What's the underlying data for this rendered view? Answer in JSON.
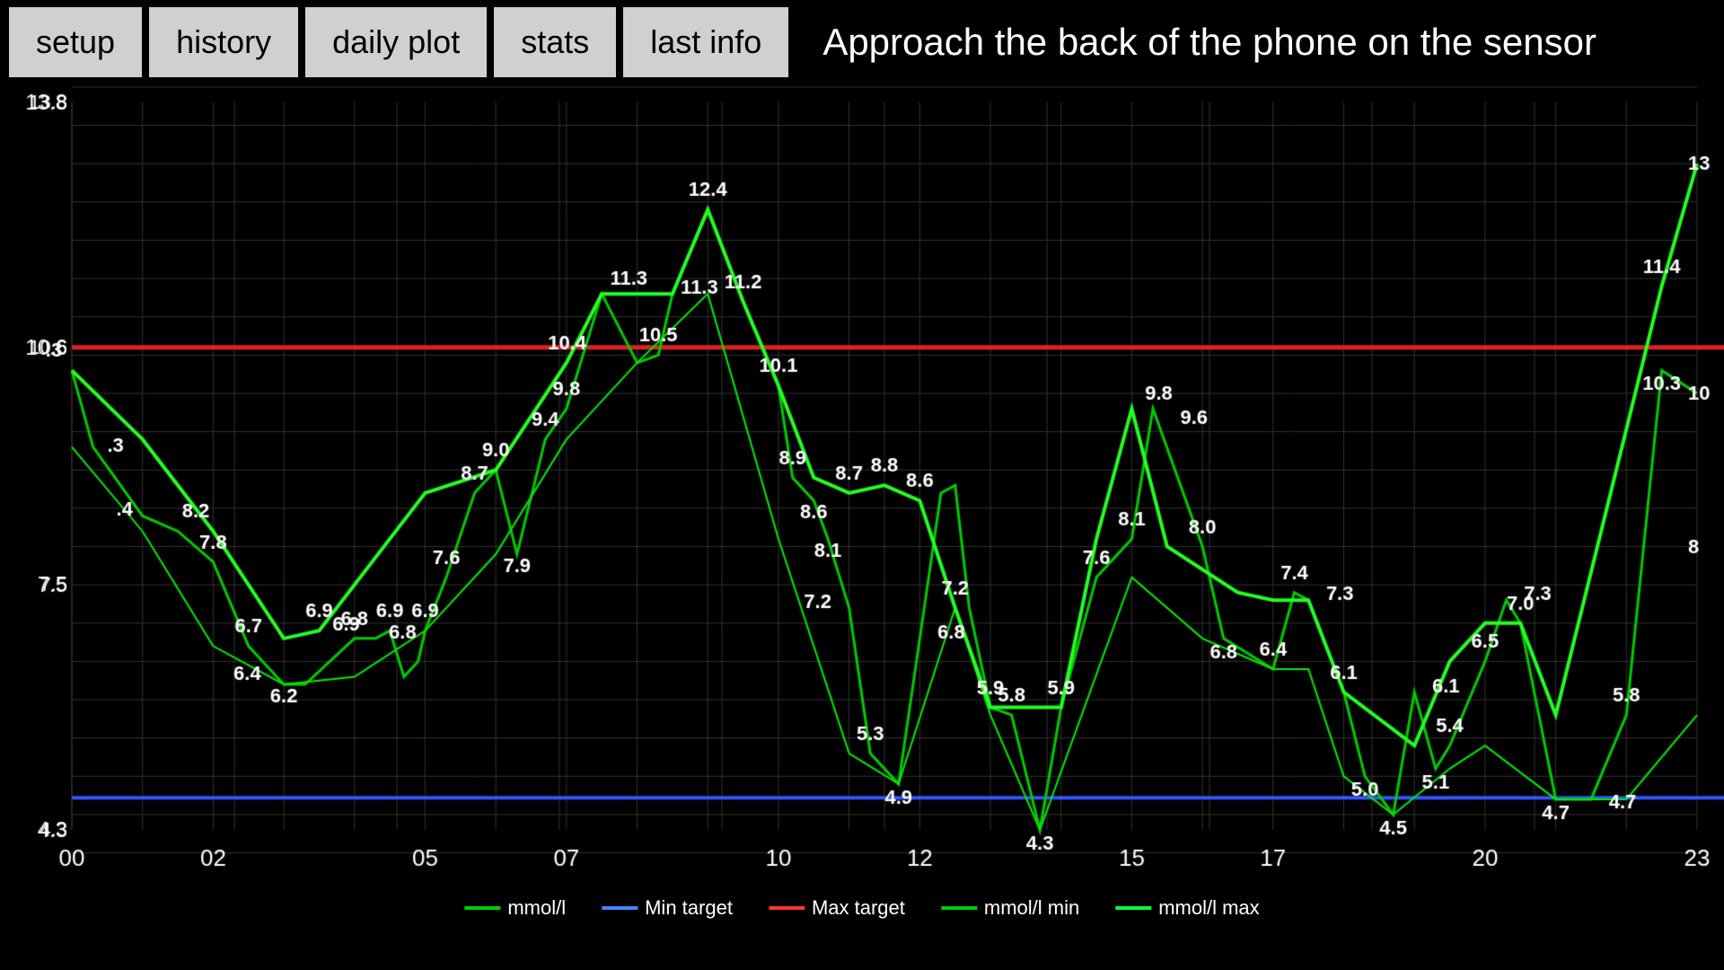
{
  "header": {
    "message": "Approach the back of the phone on the sensor",
    "buttons": [
      {
        "label": "setup",
        "name": "setup-button"
      },
      {
        "label": "history",
        "name": "history-button"
      },
      {
        "label": "daily plot",
        "name": "daily-plot-button"
      },
      {
        "label": "stats",
        "name": "stats-button"
      },
      {
        "label": "last info",
        "name": "last-info-button"
      }
    ]
  },
  "chart": {
    "yMin": 4.3,
    "yMax": 13.8,
    "redLine": 10.6,
    "blueLine": 4.7,
    "xLabels": [
      "00",
      "02",
      "05",
      "07",
      "10",
      "12",
      "15",
      "17",
      "20",
      "23"
    ],
    "legend": [
      {
        "label": "mmol/l",
        "color": "#00cc00",
        "type": "line"
      },
      {
        "label": "Min target",
        "color": "#4444ff",
        "type": "line"
      },
      {
        "label": "Max target",
        "color": "#ff2222",
        "type": "line"
      },
      {
        "label": "mmol/l min",
        "color": "#00cc00",
        "type": "line"
      },
      {
        "label": "mmol/l max",
        "color": "#00ff00",
        "type": "line"
      }
    ]
  }
}
